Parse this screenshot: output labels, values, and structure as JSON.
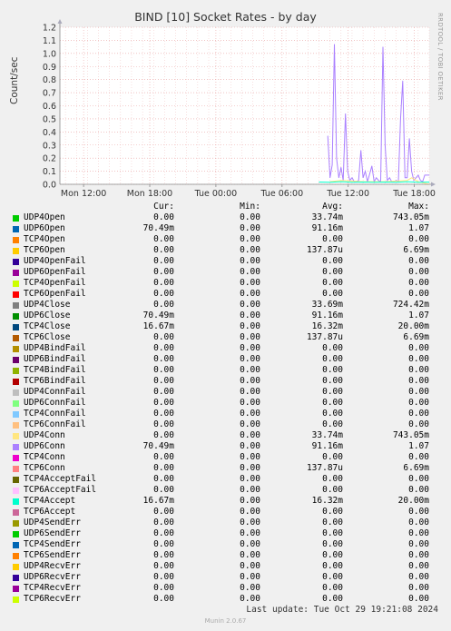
{
  "title": "BIND [10] Socket Rates - by day",
  "vertical_label": "RRDTOOL / TOBI OETIKER",
  "last_update": "Last update: Tue Oct 29 19:21:08 2024",
  "footer": "Munin 2.0.67",
  "legend_headers": {
    "cur": "Cur:",
    "min": "Min:",
    "avg": "Avg:",
    "max": "Max:"
  },
  "legend": [
    {
      "name": "UDP4Open",
      "color": "#00cc00",
      "cur": "0.00",
      "min": "0.00",
      "avg": "33.74m",
      "max": "743.05m"
    },
    {
      "name": "UDP6Open",
      "color": "#0066b3",
      "cur": "70.49m",
      "min": "0.00",
      "avg": "91.16m",
      "max": "1.07"
    },
    {
      "name": "TCP4Open",
      "color": "#ff8000",
      "cur": "0.00",
      "min": "0.00",
      "avg": "0.00",
      "max": "0.00"
    },
    {
      "name": "TCP6Open",
      "color": "#ffcc00",
      "cur": "0.00",
      "min": "0.00",
      "avg": "137.87u",
      "max": "6.69m"
    },
    {
      "name": "UDP4OpenFail",
      "color": "#330099",
      "cur": "0.00",
      "min": "0.00",
      "avg": "0.00",
      "max": "0.00"
    },
    {
      "name": "UDP6OpenFail",
      "color": "#990099",
      "cur": "0.00",
      "min": "0.00",
      "avg": "0.00",
      "max": "0.00"
    },
    {
      "name": "TCP4OpenFail",
      "color": "#ccff00",
      "cur": "0.00",
      "min": "0.00",
      "avg": "0.00",
      "max": "0.00"
    },
    {
      "name": "TCP6OpenFail",
      "color": "#ff0000",
      "cur": "0.00",
      "min": "0.00",
      "avg": "0.00",
      "max": "0.00"
    },
    {
      "name": "UDP4Close",
      "color": "#808080",
      "cur": "0.00",
      "min": "0.00",
      "avg": "33.69m",
      "max": "724.42m"
    },
    {
      "name": "UDP6Close",
      "color": "#008f00",
      "cur": "70.49m",
      "min": "0.00",
      "avg": "91.16m",
      "max": "1.07"
    },
    {
      "name": "TCP4Close",
      "color": "#00487d",
      "cur": "16.67m",
      "min": "0.00",
      "avg": "16.32m",
      "max": "20.00m"
    },
    {
      "name": "TCP6Close",
      "color": "#b35a00",
      "cur": "0.00",
      "min": "0.00",
      "avg": "137.87u",
      "max": "6.69m"
    },
    {
      "name": "UDP4BindFail",
      "color": "#b38f00",
      "cur": "0.00",
      "min": "0.00",
      "avg": "0.00",
      "max": "0.00"
    },
    {
      "name": "UDP6BindFail",
      "color": "#6b006b",
      "cur": "0.00",
      "min": "0.00",
      "avg": "0.00",
      "max": "0.00"
    },
    {
      "name": "TCP4BindFail",
      "color": "#8fb300",
      "cur": "0.00",
      "min": "0.00",
      "avg": "0.00",
      "max": "0.00"
    },
    {
      "name": "TCP6BindFail",
      "color": "#b30000",
      "cur": "0.00",
      "min": "0.00",
      "avg": "0.00",
      "max": "0.00"
    },
    {
      "name": "UDP4ConnFail",
      "color": "#bebebe",
      "cur": "0.00",
      "min": "0.00",
      "avg": "0.00",
      "max": "0.00"
    },
    {
      "name": "UDP6ConnFail",
      "color": "#80ff80",
      "cur": "0.00",
      "min": "0.00",
      "avg": "0.00",
      "max": "0.00"
    },
    {
      "name": "TCP4ConnFail",
      "color": "#80c9ff",
      "cur": "0.00",
      "min": "0.00",
      "avg": "0.00",
      "max": "0.00"
    },
    {
      "name": "TCP6ConnFail",
      "color": "#ffc080",
      "cur": "0.00",
      "min": "0.00",
      "avg": "0.00",
      "max": "0.00"
    },
    {
      "name": "UDP4Conn",
      "color": "#ffe680",
      "cur": "0.00",
      "min": "0.00",
      "avg": "33.74m",
      "max": "743.05m"
    },
    {
      "name": "UDP6Conn",
      "color": "#aa80ff",
      "cur": "70.49m",
      "min": "0.00",
      "avg": "91.16m",
      "max": "1.07"
    },
    {
      "name": "TCP4Conn",
      "color": "#ee00cc",
      "cur": "0.00",
      "min": "0.00",
      "avg": "0.00",
      "max": "0.00"
    },
    {
      "name": "TCP6Conn",
      "color": "#ff8080",
      "cur": "0.00",
      "min": "0.00",
      "avg": "137.87u",
      "max": "6.69m"
    },
    {
      "name": "TCP4AcceptFail",
      "color": "#666600",
      "cur": "0.00",
      "min": "0.00",
      "avg": "0.00",
      "max": "0.00"
    },
    {
      "name": "TCP6AcceptFail",
      "color": "#ffbfff",
      "cur": "0.00",
      "min": "0.00",
      "avg": "0.00",
      "max": "0.00"
    },
    {
      "name": "TCP4Accept",
      "color": "#00ffcc",
      "cur": "16.67m",
      "min": "0.00",
      "avg": "16.32m",
      "max": "20.00m"
    },
    {
      "name": "TCP6Accept",
      "color": "#cc6699",
      "cur": "0.00",
      "min": "0.00",
      "avg": "0.00",
      "max": "0.00"
    },
    {
      "name": "UDP4SendErr",
      "color": "#999900",
      "cur": "0.00",
      "min": "0.00",
      "avg": "0.00",
      "max": "0.00"
    },
    {
      "name": "UDP6SendErr",
      "color": "#00cc00",
      "cur": "0.00",
      "min": "0.00",
      "avg": "0.00",
      "max": "0.00"
    },
    {
      "name": "TCP4SendErr",
      "color": "#0066b3",
      "cur": "0.00",
      "min": "0.00",
      "avg": "0.00",
      "max": "0.00"
    },
    {
      "name": "TCP6SendErr",
      "color": "#ff8000",
      "cur": "0.00",
      "min": "0.00",
      "avg": "0.00",
      "max": "0.00"
    },
    {
      "name": "UDP4RecvErr",
      "color": "#ffcc00",
      "cur": "0.00",
      "min": "0.00",
      "avg": "0.00",
      "max": "0.00"
    },
    {
      "name": "UDP6RecvErr",
      "color": "#330099",
      "cur": "0.00",
      "min": "0.00",
      "avg": "0.00",
      "max": "0.00"
    },
    {
      "name": "TCP4RecvErr",
      "color": "#990099",
      "cur": "0.00",
      "min": "0.00",
      "avg": "0.00",
      "max": "0.00"
    },
    {
      "name": "TCP6RecvErr",
      "color": "#ccff00",
      "cur": "0.00",
      "min": "0.00",
      "avg": "0.00",
      "max": "0.00"
    }
  ],
  "chart_data": {
    "type": "line",
    "title": "BIND [10] Socket Rates - by day",
    "ylabel": "Count/sec",
    "xlabel": "",
    "ylim": [
      0,
      1.2
    ],
    "yticks": [
      "0.0",
      "0.1",
      "0.2",
      "0.3",
      "0.4",
      "0.5",
      "0.6",
      "0.7",
      "0.8",
      "0.9",
      "1.0",
      "1.1",
      "1.2"
    ],
    "xticks": [
      "Mon 12:00",
      "Mon 18:00",
      "Tue 00:00",
      "Tue 06:00",
      "Tue 12:00",
      "Tue 18:00"
    ],
    "xrange_hours": [
      -33.5,
      0
    ],
    "grid": true,
    "series": [
      {
        "name": "UDP6Conn",
        "color": "#aa80ff",
        "x": [
          -9.2,
          -9.0,
          -8.8,
          -8.6,
          -8.4,
          -8.2,
          -8.0,
          -7.8,
          -7.6,
          -7.4,
          -7.2,
          -7.0,
          -6.8,
          -6.6,
          -6.4,
          -6.2,
          -6.0,
          -5.8,
          -5.6,
          -5.4,
          -5.2,
          -5.0,
          -4.8,
          -4.6,
          -4.4,
          -4.2,
          -4.0,
          -3.8,
          -3.6,
          -3.4,
          -3.2,
          -3.0,
          -2.8,
          -2.6,
          -2.4,
          -2.2,
          -2.0,
          -1.8,
          -1.6,
          -1.4,
          -1.2,
          -1.0,
          -0.8,
          -0.6,
          -0.4,
          -0.2,
          0
        ],
        "y": [
          0.37,
          0.05,
          0.15,
          1.07,
          0.2,
          0.05,
          0.13,
          0.03,
          0.54,
          0.1,
          0.03,
          0.05,
          0.02,
          0.02,
          0.03,
          0.26,
          0.05,
          0.1,
          0.02,
          0.08,
          0.14,
          0.02,
          0.05,
          0.03,
          0.02,
          1.05,
          0.3,
          0.03,
          0.05,
          0.02,
          0.02,
          0.03,
          0.02,
          0.5,
          0.79,
          0.05,
          0.05,
          0.35,
          0.1,
          0.03,
          0.05,
          0.07,
          0.03,
          0.02,
          0.07,
          0.07,
          0.07
        ]
      },
      {
        "name": "UDP4Conn",
        "color": "#ffe680",
        "x": [
          -9.0,
          -8.0,
          -6.0,
          -4.0,
          -2.0,
          -1.6,
          -1.0,
          0
        ],
        "y": [
          0.02,
          0.03,
          0.02,
          0.02,
          0.03,
          0.05,
          0.02,
          0.0
        ]
      },
      {
        "name": "TCP4Accept",
        "color": "#00ffcc",
        "x": [
          -10,
          -9,
          -8,
          -7,
          -6,
          -5,
          -4,
          -3,
          -2,
          -1,
          0
        ],
        "y": [
          0.017,
          0.016,
          0.02,
          0.016,
          0.017,
          0.016,
          0.017,
          0.016,
          0.02,
          0.016,
          0.017
        ]
      }
    ]
  }
}
